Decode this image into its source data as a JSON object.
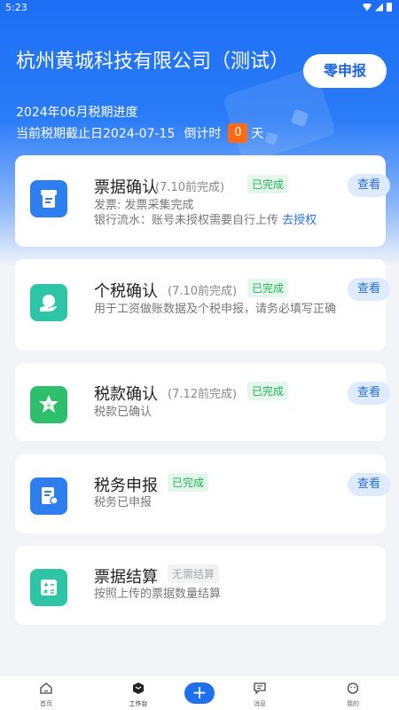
{
  "status_bar": {
    "time": "5:23",
    "icons": [
      "wifi-icon",
      "signal-icon",
      "battery-icon"
    ]
  },
  "header": {
    "company_name": "杭州黄城科技有限公司（测试）",
    "period_progress": "2024年06月税期进度",
    "deadline_text": "当前税期截止日2024-07-15",
    "countdown_label": "倒计时",
    "countdown_days": "0",
    "days_unit": "天",
    "zero_declare_button": "零申报"
  },
  "cards": [
    {
      "title": "票据确认",
      "due": "(7.10前完成)",
      "status": "已完成",
      "icon": "receipt-icon",
      "desc_line1": "发票: 发票采集完成",
      "desc_line2": "银行流水：账号未授权需要自行上传",
      "desc_link": "去授权",
      "view": "查看"
    },
    {
      "title": "个税确认",
      "due": "(7.10前完成)",
      "status": "已完成",
      "icon": "hand-payment-icon",
      "desc": "用于工资做账数据及个税申报，请务必填写正确",
      "view": "查看"
    },
    {
      "title": "税款确认",
      "due": "(7.12前完成)",
      "status": "已完成",
      "icon": "yuan-badge-icon",
      "desc": "税款已确认",
      "view": "查看"
    },
    {
      "title": "税务申报",
      "status": "已完成",
      "icon": "tax-form-icon",
      "desc": "税务已申报",
      "view": "查看"
    },
    {
      "title": "票据结算",
      "status": "无需结算",
      "icon": "calculator-icon",
      "desc": "按照上传的票据数量结算"
    }
  ],
  "tabbar": {
    "tabs": [
      {
        "label": "首页",
        "icon": "home-icon"
      },
      {
        "label": "工作台",
        "icon": "workbench-icon"
      },
      {
        "label": "消息",
        "icon": "message-icon"
      },
      {
        "label": "我的",
        "icon": "profile-icon"
      }
    ],
    "add_label": "+"
  },
  "colors": {
    "primary": "#1d6ef5",
    "done_green": "#21b35a",
    "countdown_orange": "#ff6a13",
    "icon_blue": "#2f7ef0",
    "icon_teal": "#2ec4a6",
    "icon_green": "#2dbf6c"
  }
}
